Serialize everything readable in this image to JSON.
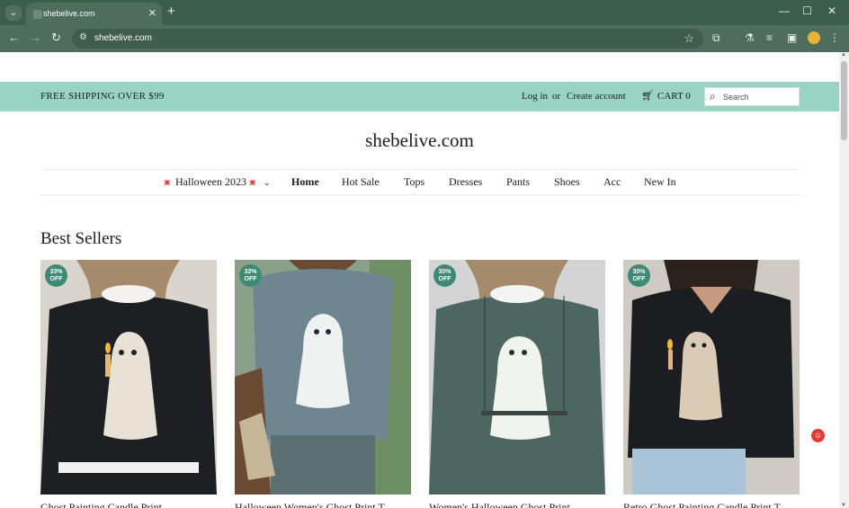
{
  "browser": {
    "tab_title": "shebelive.com",
    "url": "shebelive.com",
    "new_tab_symbol": "+",
    "tab_close_symbol": "✕",
    "window_controls": {
      "minimize": "—",
      "maximize": "☐",
      "close": "✕"
    }
  },
  "announcement": {
    "shipping": "FREE SHIPPING OVER $99",
    "login": "Log in",
    "or": "or",
    "create_account": "Create account",
    "cart": "CART 0",
    "search_placeholder": "Search"
  },
  "store": {
    "logo": "shebelive.com"
  },
  "nav": {
    "items": [
      {
        "label": "Halloween 2023",
        "has_dropdown": true,
        "icon": "ghost-emoji"
      },
      {
        "label": "Home",
        "active": true
      },
      {
        "label": "Hot Sale"
      },
      {
        "label": "Tops"
      },
      {
        "label": "Dresses"
      },
      {
        "label": "Pants"
      },
      {
        "label": "Shoes"
      },
      {
        "label": "Acc"
      },
      {
        "label": "New In"
      }
    ]
  },
  "best_sellers": {
    "title": "Best Sellers",
    "products": [
      {
        "badge_pct": "33%",
        "badge_off": "OFF",
        "title": "Ghost Painting Candle Print",
        "colors": {
          "bg": "#d9d4cc",
          "shirt": "#1e1f22",
          "ghost": "#e8e2d6"
        }
      },
      {
        "badge_pct": "32%",
        "badge_off": "OFF",
        "title": "Halloween Women's Ghost Print T",
        "colors": {
          "bg": "#8aa088",
          "shirt": "#6f8690",
          "ghost": "#eef2f0"
        }
      },
      {
        "badge_pct": "30%",
        "badge_off": "OFF",
        "title": "Women's Halloween Ghost Print",
        "colors": {
          "bg": "#d4d4d4",
          "shirt": "#4d6660",
          "ghost": "#f1f3ef"
        }
      },
      {
        "badge_pct": "30%",
        "badge_off": "OFF",
        "title": "Retro Ghost Painting Candle Print T",
        "colors": {
          "bg": "#cfcac2",
          "shirt": "#1c1d20",
          "ghost": "#d9cbb6"
        }
      }
    ]
  }
}
